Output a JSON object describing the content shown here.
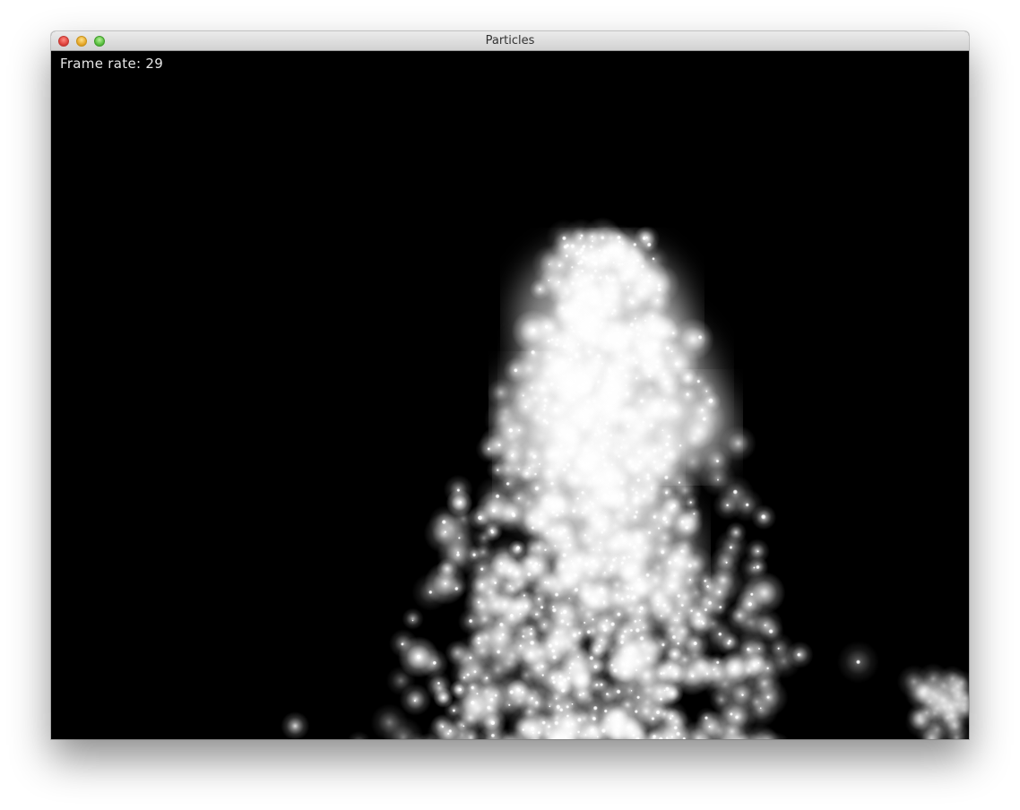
{
  "window": {
    "title": "Particles"
  },
  "overlay": {
    "frame_rate_label": "Frame rate:",
    "frame_rate_value": "29"
  },
  "colors": {
    "background": "#000000",
    "particle": "#ffffff",
    "overlay_text": "#e6e6e6"
  }
}
